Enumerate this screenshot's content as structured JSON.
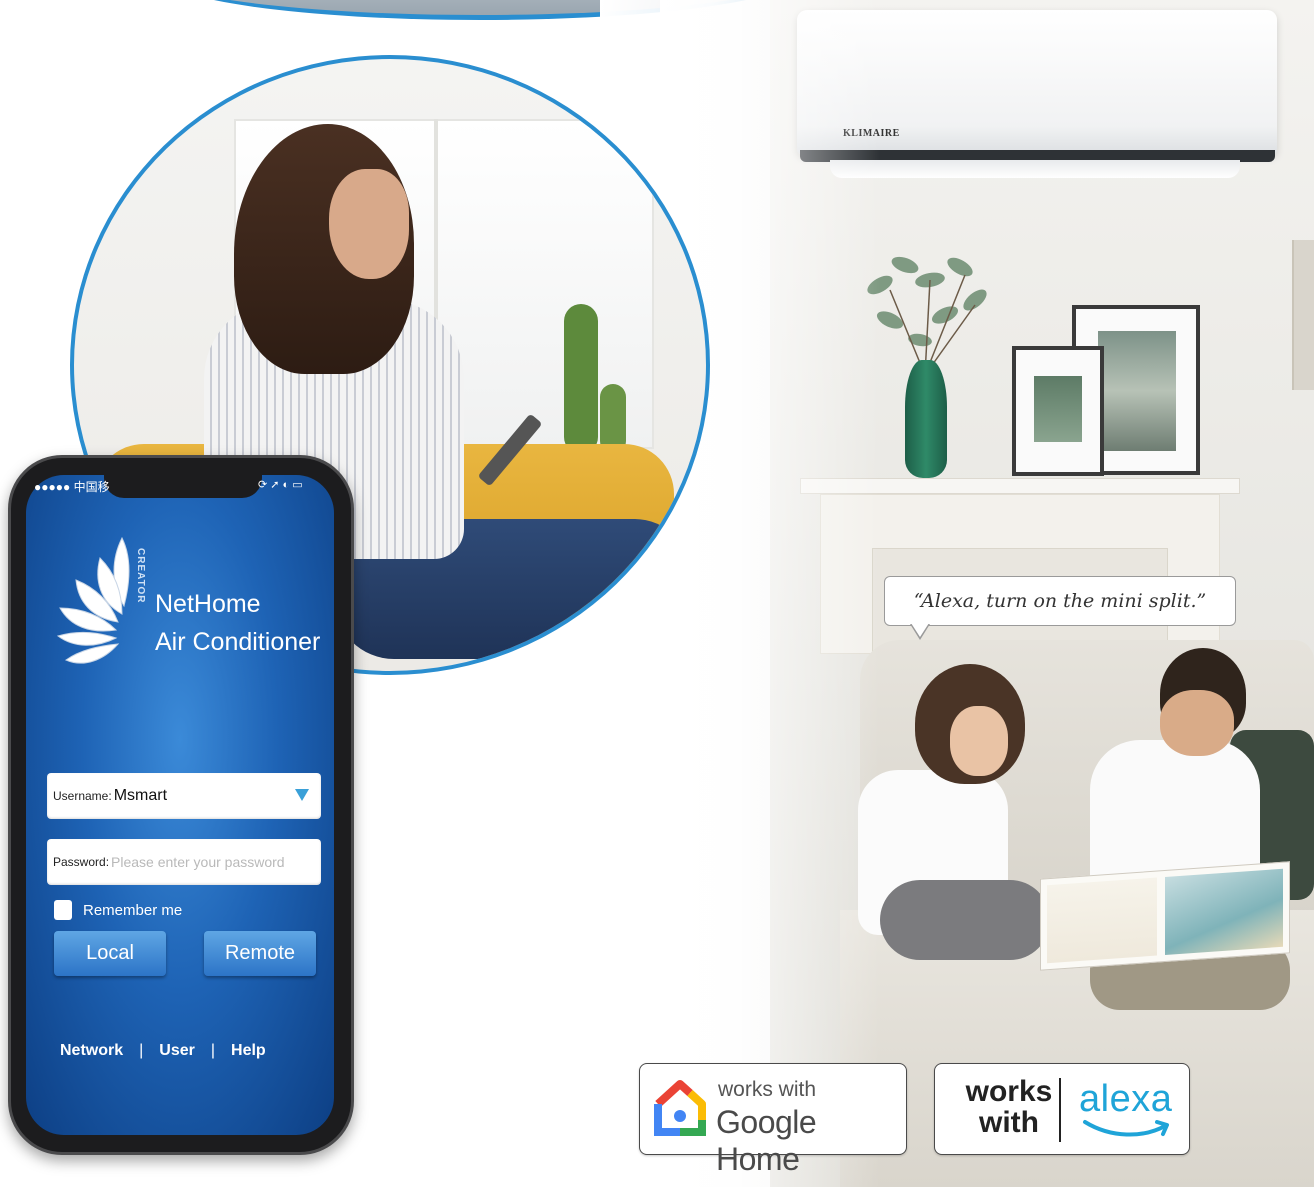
{
  "ac_unit": {
    "brand": "KLIMAIRE"
  },
  "speech_bubble": {
    "quote": "“Alexa, turn on the mini split.”"
  },
  "phone": {
    "status_left": "●●●●● 中国移",
    "app": {
      "creator_label": "CREATOR",
      "title_line1": "NetHome",
      "title_line2": "Air Conditioner"
    },
    "login": {
      "username_label": "Username:",
      "username_value": "Msmart",
      "password_label": "Password:",
      "password_placeholder": "Please enter your password",
      "remember_label": "Remember me",
      "local_button": "Local",
      "remote_button": "Remote"
    },
    "footer": {
      "network": "Network",
      "user": "User",
      "help": "Help",
      "separator": "|"
    }
  },
  "badges": {
    "google": {
      "small": "works with",
      "big": "Google Home"
    },
    "alexa": {
      "works": "works",
      "with": "with",
      "word": "alexa"
    }
  },
  "colors": {
    "accent_blue": "#2a8ed0",
    "app_blue": "#1e63b5",
    "alexa_blue": "#1fa4d8"
  },
  "icons": [
    "google-home-icon",
    "alexa-smile-icon",
    "dropdown-arrow-icon",
    "creator-logo-icon"
  ]
}
